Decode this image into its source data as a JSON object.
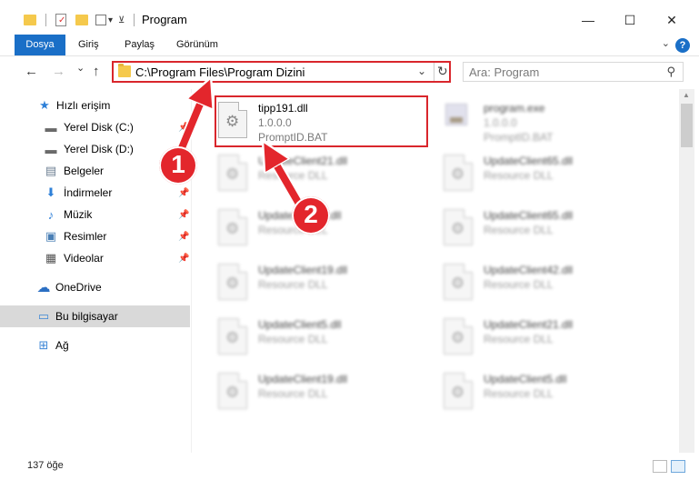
{
  "window": {
    "title": "Program",
    "minimize_glyph": "—",
    "maximize_glyph": "☐",
    "close_glyph": "✕"
  },
  "ribbon": {
    "tabs": [
      {
        "label": "Dosya"
      },
      {
        "label": "Giriş"
      },
      {
        "label": "Paylaş"
      },
      {
        "label": "Görünüm"
      }
    ],
    "help_glyph": "?",
    "chevron_glyph": "⌄"
  },
  "nav": {
    "back_glyph": "←",
    "forward_glyph": "→",
    "recent_glyph": "⌄",
    "up_glyph": "↑",
    "address": "C:\\Program Files\\Program Dizini",
    "address_dropdown_glyph": "⌄",
    "refresh_glyph": "↻",
    "search_placeholder": "Ara: Program",
    "search_glyph": "⚲"
  },
  "sidebar": {
    "items": [
      {
        "label": "Hızlı erişim",
        "icon": "star-icon",
        "glyph": "★",
        "color": "#2e80d8"
      },
      {
        "label": "Yerel Disk (C:)",
        "icon": "drive-icon",
        "glyph": "▬",
        "color": "#6a6a6a"
      },
      {
        "label": "Yerel Disk (D:)",
        "icon": "drive-icon",
        "glyph": "▬",
        "color": "#6a6a6a"
      },
      {
        "label": "Belgeler",
        "icon": "documents-icon",
        "glyph": "▤",
        "color": "#6d7f93"
      },
      {
        "label": "İndirmeler",
        "icon": "download-icon",
        "glyph": "⬇",
        "color": "#2e80d8"
      },
      {
        "label": "Müzik",
        "icon": "music-icon",
        "glyph": "♪",
        "color": "#2e80d8"
      },
      {
        "label": "Resimler",
        "icon": "pictures-icon",
        "glyph": "▣",
        "color": "#4a7fb5"
      },
      {
        "label": "Videolar",
        "icon": "videos-icon",
        "glyph": "▦",
        "color": "#555"
      },
      {
        "label": "OneDrive",
        "icon": "cloud-icon",
        "glyph": "☁",
        "color": "#2b6fc3"
      },
      {
        "label": "Bu bilgisayar",
        "icon": "computer-icon",
        "glyph": "▭",
        "color": "#3d87d6"
      },
      {
        "label": "Ağ",
        "icon": "network-icon",
        "glyph": "⊞",
        "color": "#3d87d6"
      }
    ],
    "pin_glyph": "📌"
  },
  "files": [
    {
      "name": "tipp191.dll",
      "sub1": "1.0.0.0",
      "sub2": "PromptID.BAT"
    },
    {
      "name": "program.exe",
      "sub1": "1.0.0.0",
      "sub2": "PromptID.BAT"
    },
    {
      "name": "UpdateClient21.dll",
      "sub1": "Resource DLL",
      "sub2": ""
    },
    {
      "name": "UpdateClient65.dll",
      "sub1": "Resource DLL",
      "sub2": ""
    },
    {
      "name": "UpdateClient5.dll",
      "sub1": "Resource DLL",
      "sub2": ""
    },
    {
      "name": "UpdateClient65.dll",
      "sub1": "Resource DLL",
      "sub2": ""
    },
    {
      "name": "UpdateClient19.dll",
      "sub1": "Resource DLL",
      "sub2": ""
    },
    {
      "name": "UpdateClient42.dll",
      "sub1": "Resource DLL",
      "sub2": ""
    },
    {
      "name": "UpdateClient5.dll",
      "sub1": "Resource DLL",
      "sub2": ""
    },
    {
      "name": "UpdateClient21.dll",
      "sub1": "Resource DLL",
      "sub2": ""
    },
    {
      "name": "UpdateClient19.dll",
      "sub1": "Resource DLL",
      "sub2": ""
    },
    {
      "name": "UpdateClient5.dll",
      "sub1": "Resource DLL",
      "sub2": ""
    }
  ],
  "annotations": {
    "step1": "1",
    "step2": "2",
    "color": "#e3262c"
  },
  "status": {
    "item_count": "137 öğe"
  },
  "colors": {
    "accent": "#1a6fc7",
    "highlight": "#d9262c"
  }
}
